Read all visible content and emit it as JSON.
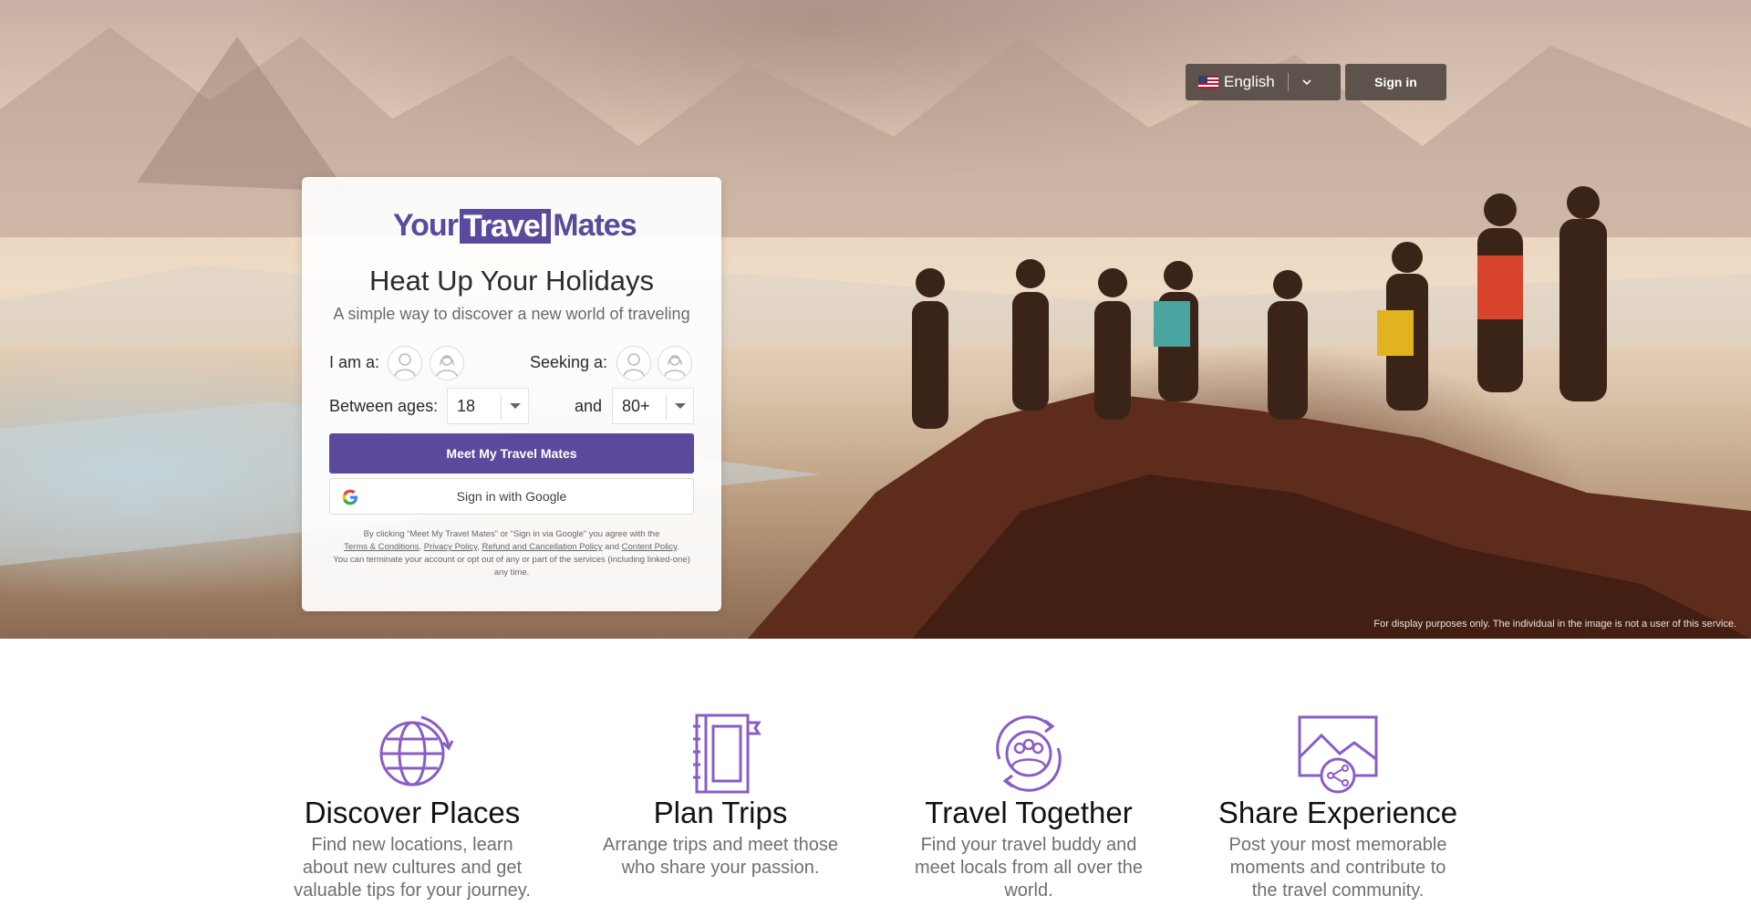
{
  "header": {
    "language": "English",
    "signin_label": "Sign in"
  },
  "hero": {
    "disclaimer": "For display purposes only. The individual in the image is not a user of this service."
  },
  "card": {
    "logo": {
      "part1": "Your",
      "part2": "Travel",
      "part3": "Mates"
    },
    "headline": "Heat Up Your Holidays",
    "subline": "A simple way to discover a new world of traveling",
    "i_am_label": "I am a:",
    "seeking_label": "Seeking a:",
    "between_label": "Between ages:",
    "and_label": "and",
    "age_min": "18",
    "age_max": "80+",
    "cta_label": "Meet My Travel Mates",
    "google_label": "Sign in with Google",
    "legal": {
      "line1": "By clicking “Meet My Travel Mates” or “Sign in via Google” you agree with the",
      "terms": "Terms & Conditions",
      "privacy": "Privacy Policy",
      "refund": "Refund and Cancellation Policy",
      "and": "and",
      "content": "Content Policy",
      "line2": "You can terminate your account or opt out of any or part of the services (including linked-one) any time."
    }
  },
  "features": [
    {
      "icon": "globe-icon",
      "title": "Discover Places",
      "desc": "Find new locations, learn about new cultures and get valuable tips for your journey."
    },
    {
      "icon": "notebook-icon",
      "title": "Plan Trips",
      "desc": "Arrange trips and meet those who share your passion."
    },
    {
      "icon": "group-icon",
      "title": "Travel Together",
      "desc": "Find your travel buddy and meet locals from all over the world."
    },
    {
      "icon": "share-photo-icon",
      "title": "Share Experience",
      "desc": "Post your most memorable moments and contribute to the travel community."
    }
  ],
  "colors": {
    "brand": "#5b4a9c",
    "icon": "#8a5cc6",
    "header_button": "#5d534c"
  }
}
